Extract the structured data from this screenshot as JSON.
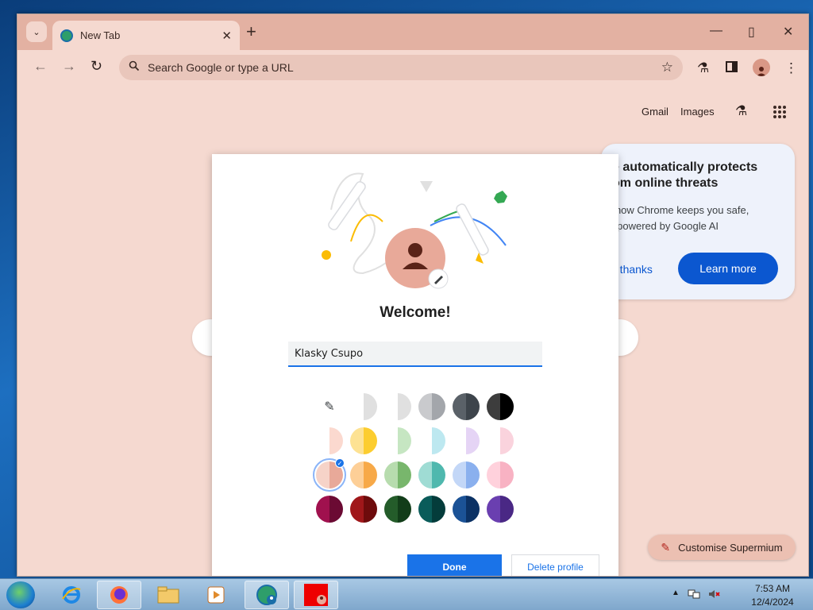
{
  "browser": {
    "tab_title": "New Tab",
    "new_tab_glyph": "+",
    "omnibox_placeholder": "Search Google or type a URL",
    "window_controls": {
      "minimize": "—",
      "maximize": "▯",
      "close": "✕"
    }
  },
  "ntp": {
    "links": {
      "gmail": "Gmail",
      "images": "Images"
    },
    "promo": {
      "heading": "e automatically protects\nom online threats",
      "body": "r how Chrome keeps you safe,\ny powered by Google AI",
      "no_thanks": "o thanks",
      "learn_more": "Learn more"
    },
    "customise_label": "Customise Supermium"
  },
  "dialog": {
    "welcome": "Welcome!",
    "name_value": "Klasky Csupo",
    "done_label": "Done",
    "delete_label": "Delete profile",
    "selected_color": "peach",
    "colors": [
      [
        "#ffffff",
        "#ffffff",
        "#e0e0e0",
        "#ffffff",
        "#e0e0e0",
        "#c9cacd",
        "#a3a6ab",
        "#5a6168",
        "#3d444b",
        "#3d3d3d",
        "#000000"
      ],
      [
        "#ffffff",
        "#fbd9cf",
        "#ffffff",
        "#fde293",
        "#fccd2f",
        "#ffffff",
        "#c6e6c2",
        "#ffffff",
        "#bde8f0",
        "#ffffff",
        "#e5d4f5",
        "#ffffff",
        "#fad3dd"
      ],
      [
        "#f6d3c8",
        "#e8a999",
        "#fdcf97",
        "#f7a948",
        "#b7dcae",
        "#78b66c",
        "#9fdcd4",
        "#4fb8ae",
        "#c3d7f7",
        "#8ab0ee",
        "#ffd1dc",
        "#f8b2c3"
      ],
      [
        "#a0114e",
        "#6b0a33",
        "#a0171a",
        "#6e0b0c",
        "#245c2a",
        "#123d19",
        "#0a5c5a",
        "#043c3b",
        "#1b5296",
        "#0b3164",
        "#6a3fb0",
        "#4a2885"
      ]
    ]
  },
  "taskbar": {
    "time": "7:53 AM",
    "date": "12/4/2024"
  }
}
